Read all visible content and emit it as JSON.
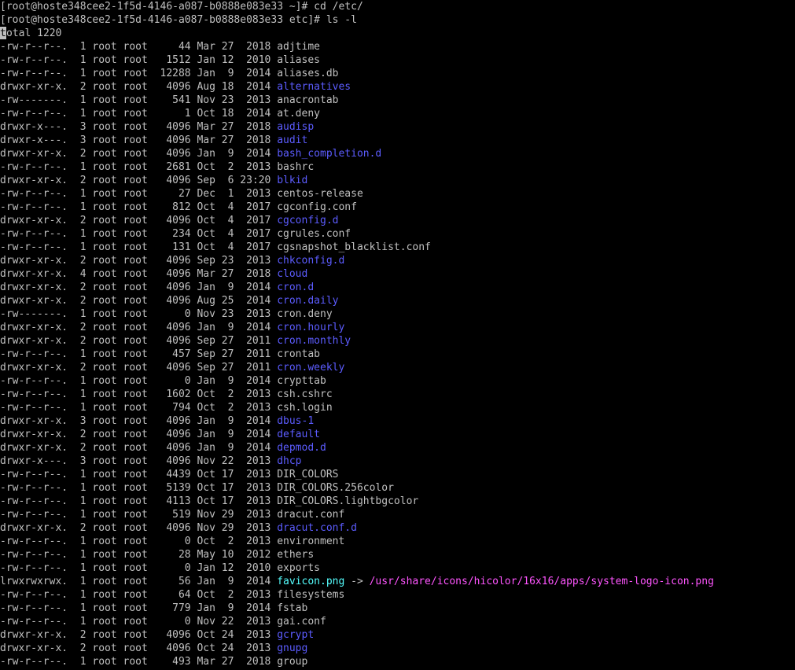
{
  "terminal": {
    "colors": {
      "background": "#000000",
      "text": "#c0c0c0",
      "directory": "#5c5cff",
      "symlink": "#55ffff",
      "symlink_target": "#ff55ff"
    },
    "prompts": [
      "[root@hoste348cee2-1f5d-4146-a087-b0888e083e33 ~]# cd /etc/",
      "[root@hoste348cee2-1f5d-4146-a087-b0888e083e33 etc]# ls -l"
    ],
    "total": {
      "cursor_char": "t",
      "rest": "otal 1220"
    },
    "entries": [
      {
        "meta": "-rw-r--r--.  1 root root     44 Mar 27  2018 ",
        "name": "adjtime",
        "kind": "file"
      },
      {
        "meta": "-rw-r--r--.  1 root root   1512 Jan 12  2010 ",
        "name": "aliases",
        "kind": "file"
      },
      {
        "meta": "-rw-r--r--.  1 root root  12288 Jan  9  2014 ",
        "name": "aliases.db",
        "kind": "file"
      },
      {
        "meta": "drwxr-xr-x.  2 root root   4096 Aug 18  2014 ",
        "name": "alternatives",
        "kind": "dir"
      },
      {
        "meta": "-rw-------.  1 root root    541 Nov 23  2013 ",
        "name": "anacrontab",
        "kind": "file"
      },
      {
        "meta": "-rw-r--r--.  1 root root      1 Oct 18  2014 ",
        "name": "at.deny",
        "kind": "file"
      },
      {
        "meta": "drwxr-x---.  3 root root   4096 Mar 27  2018 ",
        "name": "audisp",
        "kind": "dir"
      },
      {
        "meta": "drwxr-x---.  3 root root   4096 Mar 27  2018 ",
        "name": "audit",
        "kind": "dir"
      },
      {
        "meta": "drwxr-xr-x.  2 root root   4096 Jan  9  2014 ",
        "name": "bash_completion.d",
        "kind": "dir"
      },
      {
        "meta": "-rw-r--r--.  1 root root   2681 Oct  2  2013 ",
        "name": "bashrc",
        "kind": "file"
      },
      {
        "meta": "drwxr-xr-x.  2 root root   4096 Sep  6 23:20 ",
        "name": "blkid",
        "kind": "dir"
      },
      {
        "meta": "-rw-r--r--.  1 root root     27 Dec  1  2013 ",
        "name": "centos-release",
        "kind": "file"
      },
      {
        "meta": "-rw-r--r--.  1 root root    812 Oct  4  2017 ",
        "name": "cgconfig.conf",
        "kind": "file"
      },
      {
        "meta": "drwxr-xr-x.  2 root root   4096 Oct  4  2017 ",
        "name": "cgconfig.d",
        "kind": "dir"
      },
      {
        "meta": "-rw-r--r--.  1 root root    234 Oct  4  2017 ",
        "name": "cgrules.conf",
        "kind": "file"
      },
      {
        "meta": "-rw-r--r--.  1 root root    131 Oct  4  2017 ",
        "name": "cgsnapshot_blacklist.conf",
        "kind": "file"
      },
      {
        "meta": "drwxr-xr-x.  2 root root   4096 Sep 23  2013 ",
        "name": "chkconfig.d",
        "kind": "dir"
      },
      {
        "meta": "drwxr-xr-x.  4 root root   4096 Mar 27  2018 ",
        "name": "cloud",
        "kind": "dir"
      },
      {
        "meta": "drwxr-xr-x.  2 root root   4096 Jan  9  2014 ",
        "name": "cron.d",
        "kind": "dir"
      },
      {
        "meta": "drwxr-xr-x.  2 root root   4096 Aug 25  2014 ",
        "name": "cron.daily",
        "kind": "dir"
      },
      {
        "meta": "-rw-------.  1 root root      0 Nov 23  2013 ",
        "name": "cron.deny",
        "kind": "file"
      },
      {
        "meta": "drwxr-xr-x.  2 root root   4096 Jan  9  2014 ",
        "name": "cron.hourly",
        "kind": "dir"
      },
      {
        "meta": "drwxr-xr-x.  2 root root   4096 Sep 27  2011 ",
        "name": "cron.monthly",
        "kind": "dir"
      },
      {
        "meta": "-rw-r--r--.  1 root root    457 Sep 27  2011 ",
        "name": "crontab",
        "kind": "file"
      },
      {
        "meta": "drwxr-xr-x.  2 root root   4096 Sep 27  2011 ",
        "name": "cron.weekly",
        "kind": "dir"
      },
      {
        "meta": "-rw-r--r--.  1 root root      0 Jan  9  2014 ",
        "name": "crypttab",
        "kind": "file"
      },
      {
        "meta": "-rw-r--r--.  1 root root   1602 Oct  2  2013 ",
        "name": "csh.cshrc",
        "kind": "file"
      },
      {
        "meta": "-rw-r--r--.  1 root root    794 Oct  2  2013 ",
        "name": "csh.login",
        "kind": "file"
      },
      {
        "meta": "drwxr-xr-x.  3 root root   4096 Jan  9  2014 ",
        "name": "dbus-1",
        "kind": "dir"
      },
      {
        "meta": "drwxr-xr-x.  2 root root   4096 Jan  9  2014 ",
        "name": "default",
        "kind": "dir"
      },
      {
        "meta": "drwxr-xr-x.  2 root root   4096 Jan  9  2014 ",
        "name": "depmod.d",
        "kind": "dir"
      },
      {
        "meta": "drwxr-x---.  3 root root   4096 Nov 22  2013 ",
        "name": "dhcp",
        "kind": "dir"
      },
      {
        "meta": "-rw-r--r--.  1 root root   4439 Oct 17  2013 ",
        "name": "DIR_COLORS",
        "kind": "file"
      },
      {
        "meta": "-rw-r--r--.  1 root root   5139 Oct 17  2013 ",
        "name": "DIR_COLORS.256color",
        "kind": "file"
      },
      {
        "meta": "-rw-r--r--.  1 root root   4113 Oct 17  2013 ",
        "name": "DIR_COLORS.lightbgcolor",
        "kind": "file"
      },
      {
        "meta": "-rw-r--r--.  1 root root    519 Nov 29  2013 ",
        "name": "dracut.conf",
        "kind": "file"
      },
      {
        "meta": "drwxr-xr-x.  2 root root   4096 Nov 29  2013 ",
        "name": "dracut.conf.d",
        "kind": "dir"
      },
      {
        "meta": "-rw-r--r--.  1 root root      0 Oct  2  2013 ",
        "name": "environment",
        "kind": "file"
      },
      {
        "meta": "-rw-r--r--.  1 root root     28 May 10  2012 ",
        "name": "ethers",
        "kind": "file"
      },
      {
        "meta": "-rw-r--r--.  1 root root      0 Jan 12  2010 ",
        "name": "exports",
        "kind": "file"
      },
      {
        "meta": "lrwxrwxrwx.  1 root root     56 Jan  9  2014 ",
        "name": "favicon.png",
        "kind": "link",
        "arrow": " -> ",
        "target": "/usr/share/icons/hicolor/16x16/apps/system-logo-icon.png"
      },
      {
        "meta": "-rw-r--r--.  1 root root     64 Oct  2  2013 ",
        "name": "filesystems",
        "kind": "file"
      },
      {
        "meta": "-rw-r--r--.  1 root root    779 Jan  9  2014 ",
        "name": "fstab",
        "kind": "file"
      },
      {
        "meta": "-rw-r--r--.  1 root root      0 Nov 22  2013 ",
        "name": "gai.conf",
        "kind": "file"
      },
      {
        "meta": "drwxr-xr-x.  2 root root   4096 Oct 24  2013 ",
        "name": "gcrypt",
        "kind": "dir"
      },
      {
        "meta": "drwxr-xr-x.  2 root root   4096 Oct 24  2013 ",
        "name": "gnupg",
        "kind": "dir"
      },
      {
        "meta": "-rw-r--r--.  1 root root    493 Mar 27  2018 ",
        "name": "group",
        "kind": "file"
      }
    ]
  }
}
